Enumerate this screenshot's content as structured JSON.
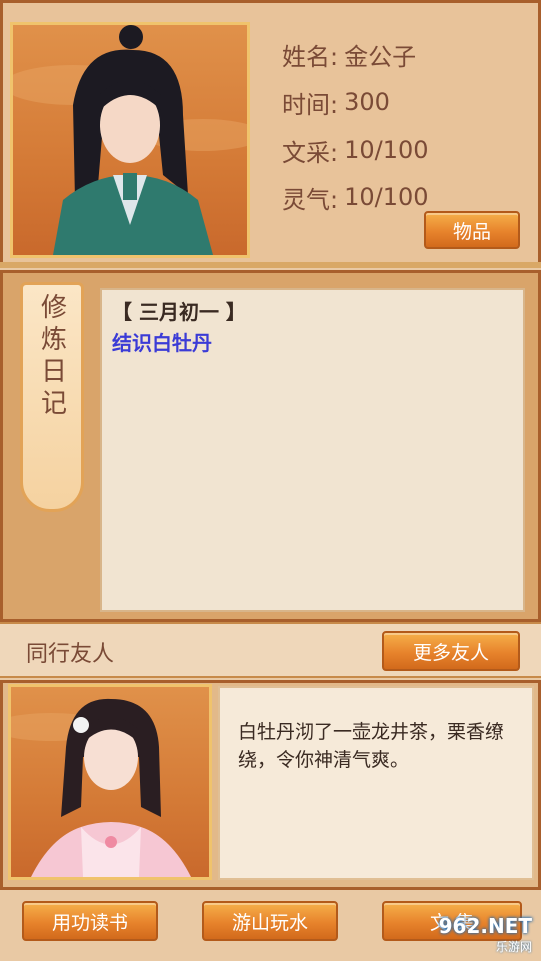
{
  "profile": {
    "name_label": "姓名:",
    "name_value": "金公子",
    "time_label": "时间:",
    "time_value": "300",
    "literary_label": "文采:",
    "literary_value": "10/100",
    "spirit_label": "灵气:",
    "spirit_value": "10/100",
    "items_button": "物品"
  },
  "diary": {
    "tab_title": "修炼日记",
    "date": "【 三月初一 】",
    "entry": "结识白牡丹"
  },
  "companion": {
    "section_title": "同行友人",
    "more_button": "更多友人",
    "message": "白牡丹沏了一壶龙井茶，栗香缭绕，令你神清气爽。"
  },
  "actions": {
    "study": "用功读书",
    "travel": "游山玩水",
    "third": "文 集"
  },
  "watermark": {
    "text": "962.NET",
    "sub": "乐游网"
  },
  "colors": {
    "background": "#e9c9a4",
    "frame": "#a85f2c",
    "button": "#e7832c",
    "label_text": "#7a4a36",
    "diary_entry": "#3b3bd6"
  }
}
